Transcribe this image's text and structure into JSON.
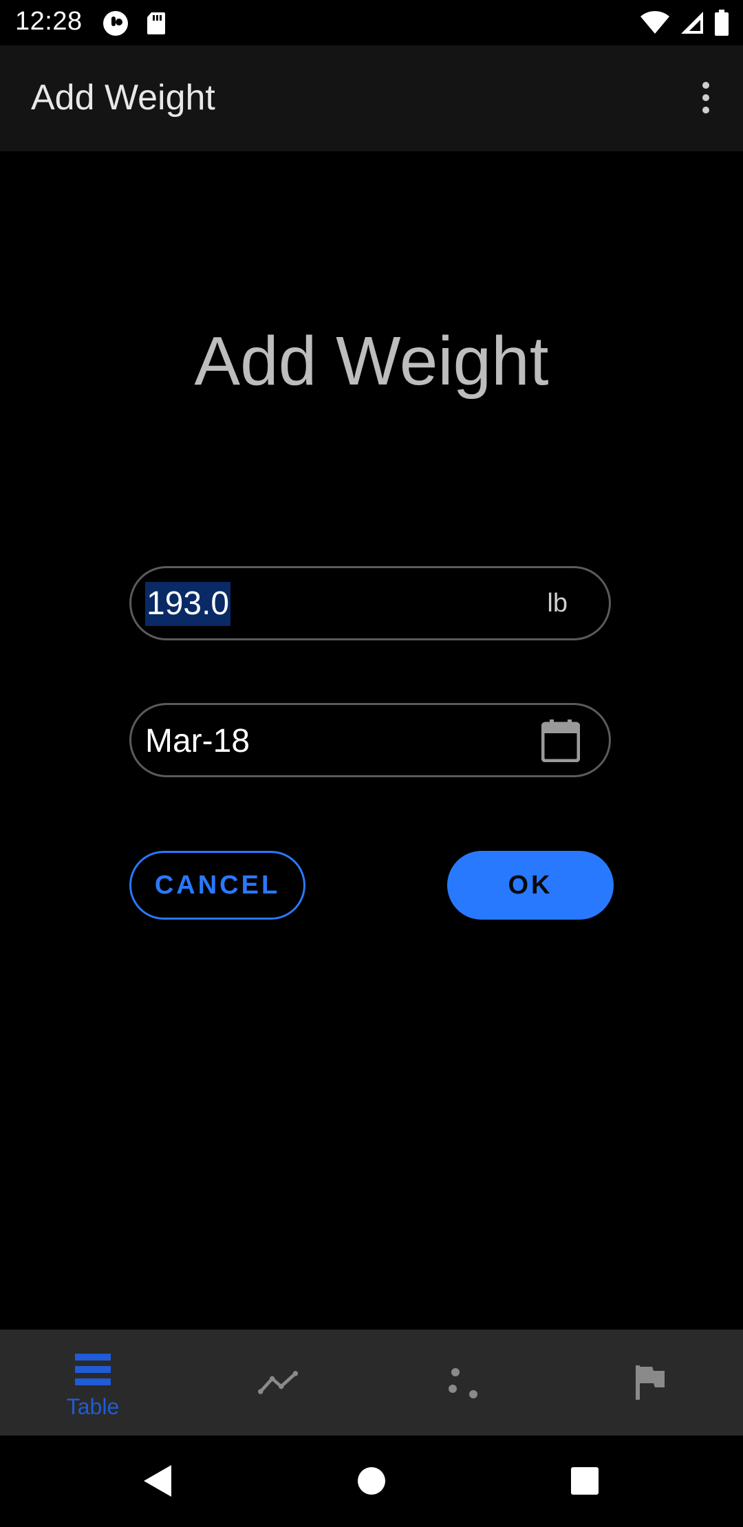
{
  "status_bar": {
    "time": "12:28",
    "left_icons": [
      "notification-app-icon",
      "sd-card-icon"
    ],
    "right_icons": [
      "wifi-icon",
      "signal-icon",
      "battery-icon"
    ]
  },
  "app_bar": {
    "title": "Add Weight",
    "menu_icon": "more-vert-icon"
  },
  "dialog": {
    "heading": "Add Weight",
    "weight": {
      "value": "193.0",
      "unit": "lb",
      "selected": true
    },
    "date": {
      "value": "Mar-18",
      "icon": "calendar-icon"
    },
    "buttons": {
      "cancel": "CANCEL",
      "ok": "OK"
    }
  },
  "bottom_nav": {
    "items": [
      {
        "label": "Table",
        "icon": "table-list-icon",
        "active": true
      },
      {
        "label": "",
        "icon": "line-chart-icon",
        "active": false
      },
      {
        "label": "",
        "icon": "scatter-icon",
        "active": false
      },
      {
        "label": "",
        "icon": "flag-icon",
        "active": false
      }
    ]
  },
  "system_nav": {
    "buttons": [
      "back-icon",
      "home-icon",
      "recents-icon"
    ]
  },
  "colors": {
    "accent": "#2979ff",
    "active_nav": "#1f5cd6",
    "app_bar_bg": "#141414",
    "bottom_nav_bg": "#2a2a2a",
    "background": "#000000",
    "field_border": "#5b5b5b",
    "selection_bg": "#0a2a66"
  }
}
